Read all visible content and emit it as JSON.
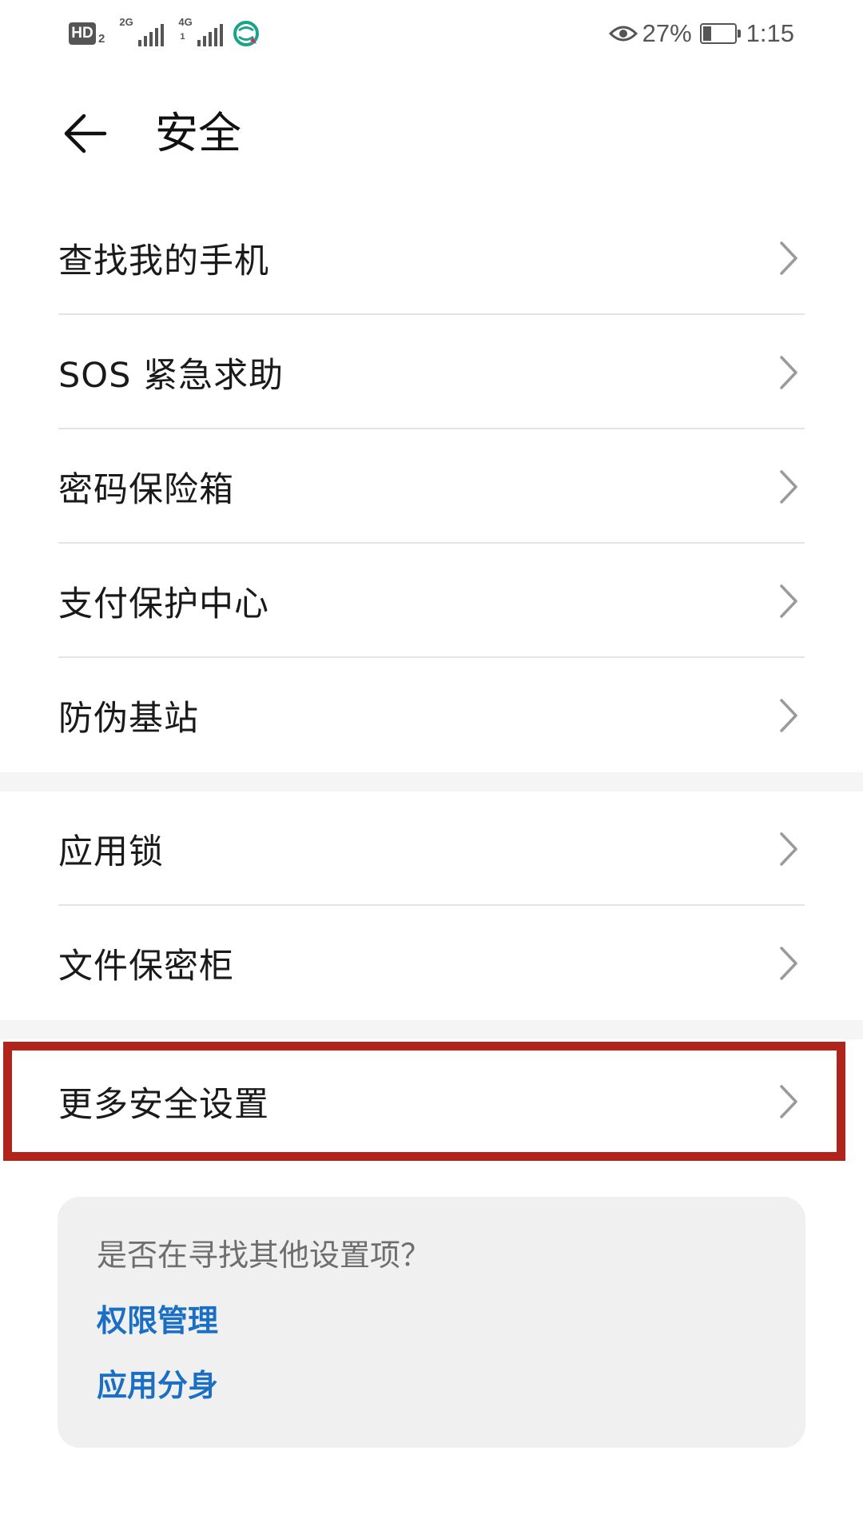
{
  "status_bar": {
    "hd_label": "HD",
    "hd_sub": "2",
    "sim1_network": "2G",
    "sim2_network": "4G",
    "sim2_slot": "1",
    "battery_percent": "27%",
    "battery_level": 0.27,
    "time": "1:15",
    "icons": [
      "eye-icon",
      "signal-icon",
      "carrier-logo-icon",
      "battery-icon"
    ]
  },
  "header": {
    "back_icon": "arrow-left-icon",
    "title": "安全"
  },
  "group1": {
    "items": [
      {
        "label": "查找我的手机"
      },
      {
        "label": "SOS 紧急求助"
      },
      {
        "label": "密码保险箱"
      },
      {
        "label": "支付保护中心"
      },
      {
        "label": "防伪基站"
      }
    ]
  },
  "group2": {
    "items": [
      {
        "label": "应用锁"
      },
      {
        "label": "文件保密柜"
      }
    ]
  },
  "group3": {
    "items": [
      {
        "label": "更多安全设置"
      }
    ]
  },
  "suggestions": {
    "title": "是否在寻找其他设置项？",
    "links": [
      {
        "label": "权限管理"
      },
      {
        "label": "应用分身"
      }
    ]
  },
  "colors": {
    "link": "#1a6fc4",
    "highlight_border": "#b0241b",
    "divider": "#e4e4e4",
    "card_bg": "#f0f0f0"
  }
}
